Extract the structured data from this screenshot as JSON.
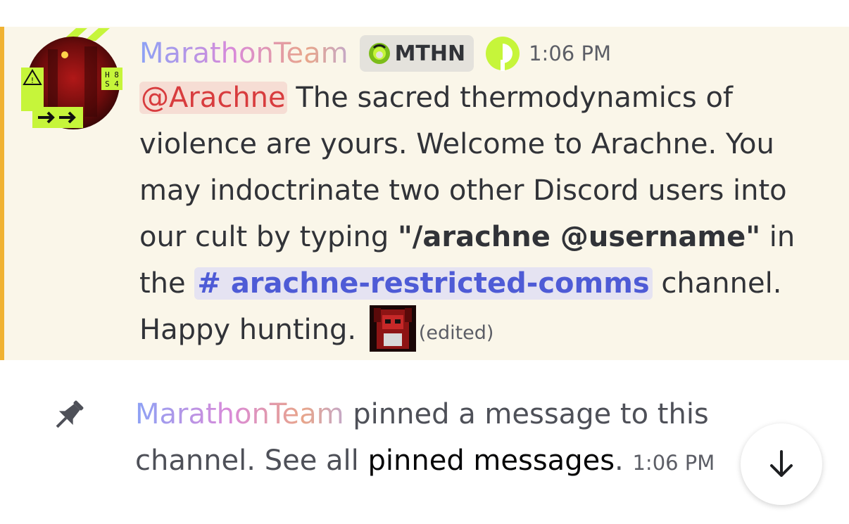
{
  "message": {
    "username": "MarathonTeam",
    "clan_tag": "MTHN",
    "timestamp": "1:06 PM",
    "mention": "@Arachne",
    "text_1": " The sacred thermodynamics of violence are yours. Welcome to Arachne. You may indoctrinate two other Discord users into our cult by typing ",
    "command": "\"/arachne @username\"",
    "text_2": " in the ",
    "channel_hash": "#",
    "channel": "arachne-restricted-comms",
    "text_3": " channel. Happy hunting.",
    "edited": "(edited)",
    "avatar_label": "H8 S4",
    "emoji": "custom-emoji-red-character"
  },
  "system_message": {
    "username": "MarathonTeam",
    "text_1": " pinned a message to this channel. See all ",
    "link": "pinned messages",
    "text_2": ".",
    "timestamp": "1:06 PM"
  },
  "icons": {
    "pin": "pin-icon",
    "scroll": "arrow-down-icon",
    "role": "role-icon",
    "clan": "clan-badge-icon"
  },
  "colors": {
    "highlight_bg": "#faf6e9",
    "highlight_bar": "#f0b232",
    "mention_text": "#d83c3e",
    "channel_text": "#4e5bd6",
    "accent_green": "#c6f53a"
  }
}
